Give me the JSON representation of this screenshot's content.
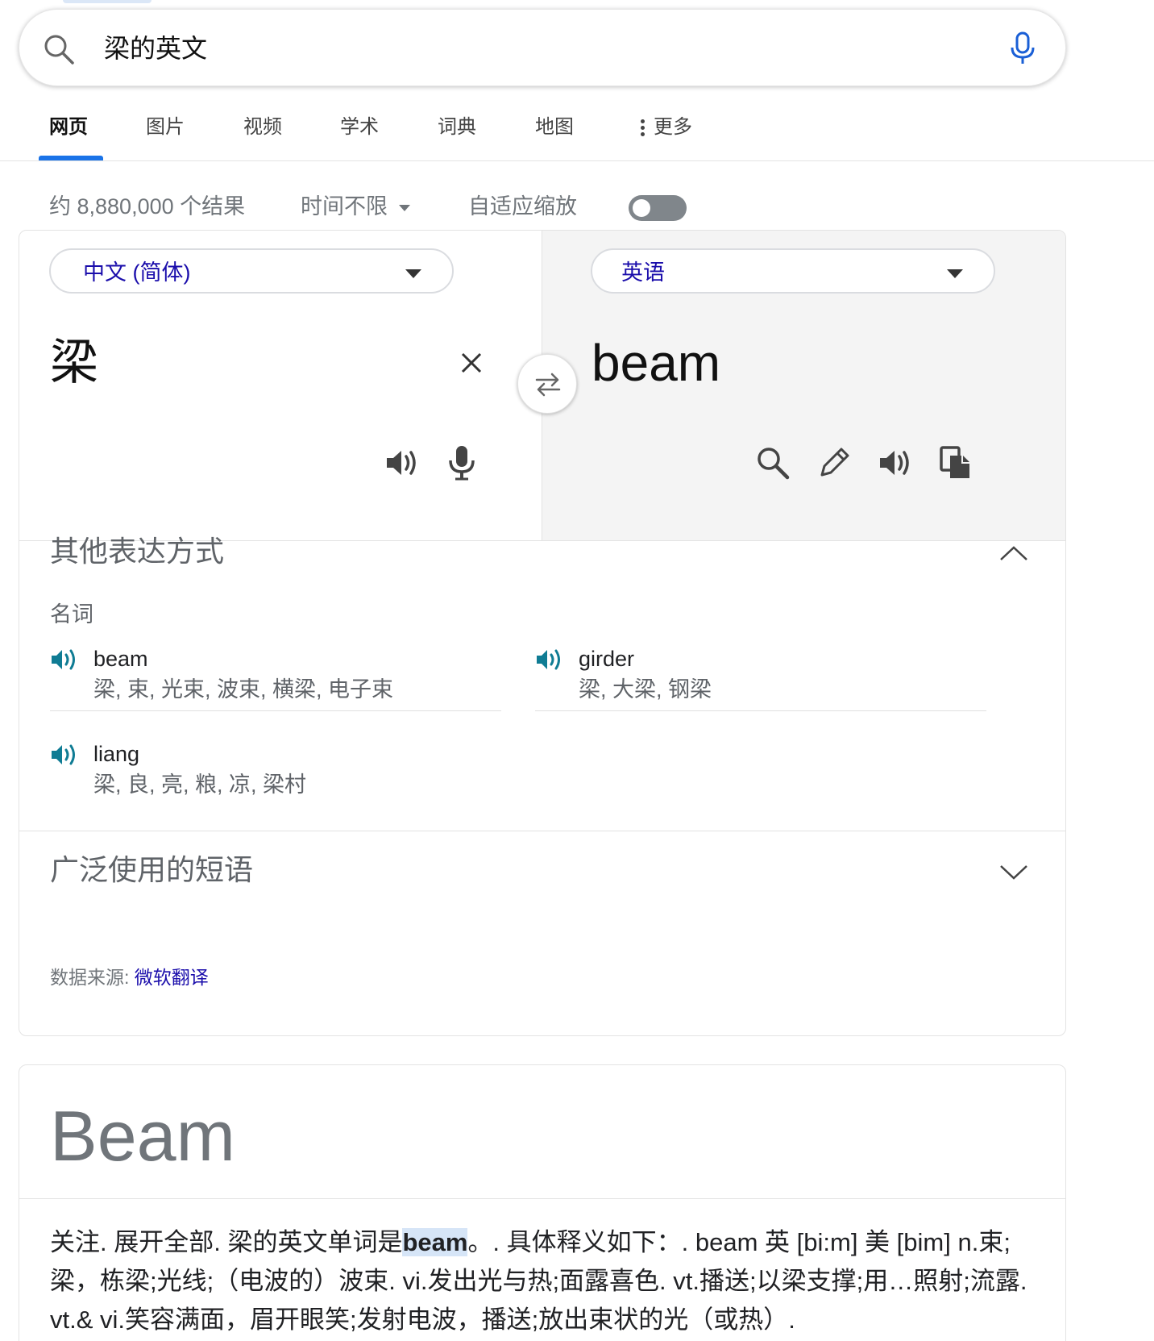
{
  "search": {
    "query": "梁的英文"
  },
  "tabs": [
    {
      "label": "网页",
      "active": true
    },
    {
      "label": "图片"
    },
    {
      "label": "视频"
    },
    {
      "label": "学术"
    },
    {
      "label": "词典"
    },
    {
      "label": "地图"
    },
    {
      "label": "更多"
    }
  ],
  "results_meta": {
    "count": "约 8,880,000 个结果",
    "time_filter": "时间不限",
    "adaptive_zoom": "自适应缩放",
    "adaptive_zoom_on": false
  },
  "translator": {
    "source_lang": "中文 (简体)",
    "target_lang": "英语",
    "source_text": "梁",
    "target_text": "beam",
    "icons": {
      "clear": "close-icon",
      "swap": "swap-icon",
      "source_actions": [
        "speaker-icon",
        "mic-icon"
      ],
      "target_actions": [
        "search-icon",
        "pencil-icon",
        "speaker-icon",
        "copy-icon"
      ]
    }
  },
  "alternatives": {
    "title": "其他表达方式",
    "pos": "名词",
    "items": [
      {
        "word": "beam",
        "synonyms": "梁, 束, 光束, 波束, 横梁, 电子束"
      },
      {
        "word": "girder",
        "synonyms": "梁, 大梁, 钢梁"
      },
      {
        "word": "liang",
        "synonyms": "梁, 良, 亮, 粮, 凉, 梁村"
      }
    ]
  },
  "phrases": {
    "title": "广泛使用的短语"
  },
  "source": {
    "label": "数据来源:",
    "link": "微软翻译"
  },
  "beam_card": {
    "title": "Beam",
    "body_pre": "关注. 展开全部. 梁的英文单词是",
    "body_highlight": "beam",
    "body_post": "。. 具体释义如下：. beam 英 [bi:m] 美 [bim] n.束;梁，栋梁;光线;（电波的）波束. vi.发出光与热;面露喜色. vt.播送;以梁支撑;用…照射;流露. vt.& vi.笑容满面，眉开眼笑;发射电波，播送;放出束状的光（或热）."
  },
  "colors": {
    "accent": "#1a73e8",
    "link": "#1a0dab",
    "speaker_teal": "#0f7c94"
  }
}
